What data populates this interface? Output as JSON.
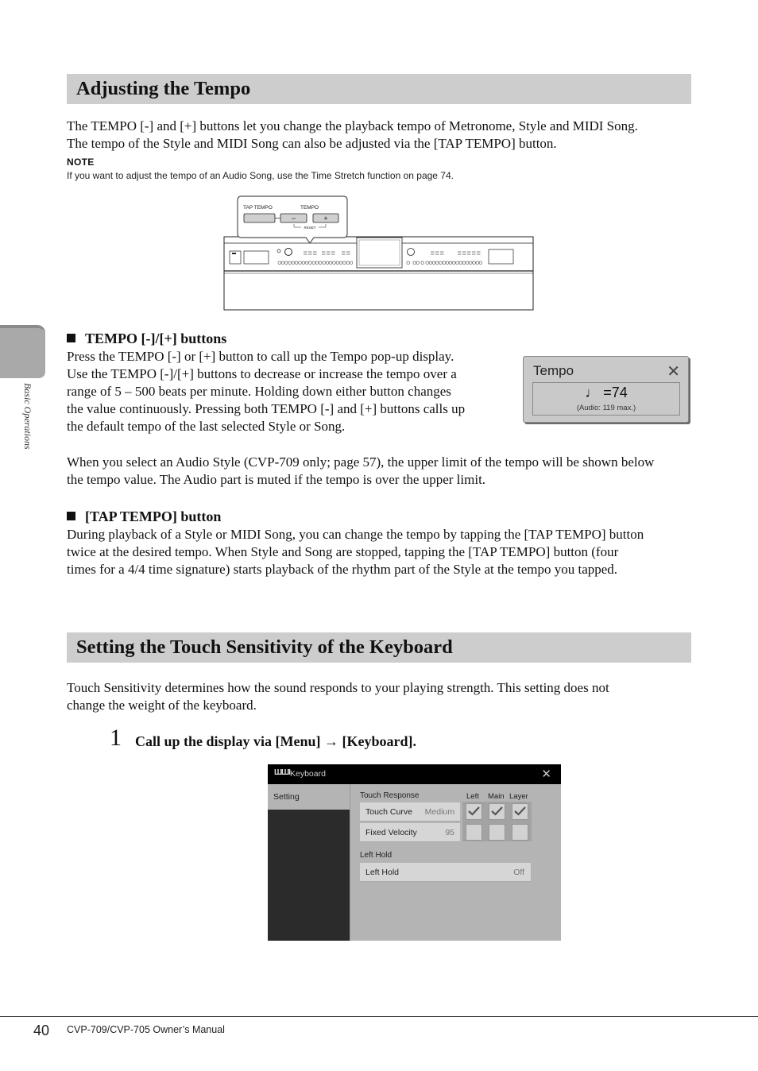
{
  "section1": {
    "heading": "Adjusting the Tempo",
    "intro_line1": "The TEMPO [-] and [+] buttons let you change the playback tempo of Metronome, Style and MIDI Song.",
    "intro_line2": "The tempo of the Style and MIDI Song can also be adjusted via the [TAP TEMPO] button.",
    "note_label": "NOTE",
    "note_text": "If you want to adjust the tempo of an Audio Song, use the Time Stretch function on page 74.",
    "illustration": {
      "tap_tempo_label": "TAP TEMPO",
      "tempo_label": "TEMPO",
      "minus_label": "−",
      "plus_label": "+",
      "reset_label": "RESET"
    },
    "sub1": {
      "heading": "TEMPO [-]/[+] buttons",
      "lines": [
        "Press the TEMPO [-] or [+] button to call up the Tempo pop-up display.",
        "Use the TEMPO [-]/[+] buttons to decrease or increase the tempo over a",
        "range of 5 – 500 beats per minute. Holding down either button changes",
        "the value continuously. Pressing both TEMPO [-] and [+] buttons calls up",
        "the default tempo of the last selected Style or Song."
      ],
      "audio_line1": "When you select an Audio Style (CVP-709 only; page 57), the upper limit of the tempo will be shown below",
      "audio_line2": "the tempo value. The Audio part is muted if the tempo is over the upper limit."
    },
    "tempo_popup": {
      "title": "Tempo",
      "close_icon": "✕",
      "value": "♩ =74",
      "audio_max": "(Audio: 119 max.)"
    },
    "sub2": {
      "heading": "[TAP TEMPO] button",
      "lines": [
        "During playback of a Style or MIDI Song, you can change the tempo by tapping the [TAP TEMPO] button",
        "twice at the desired tempo. When Style and Song are stopped, tapping the [TAP TEMPO] button (four",
        "times for a 4/4 time signature) starts playback of the rhythm part of the Style at the tempo you tapped."
      ]
    }
  },
  "section2": {
    "heading": "Setting the Touch Sensitivity of the Keyboard",
    "intro_line1": "Touch Sensitivity determines how the sound responds to your playing strength. This setting does not",
    "intro_line2": "change the weight of the keyboard.",
    "step": {
      "number": "1",
      "text": "Call up the display via [Menu] → [Keyboard]."
    },
    "keyboard_screen": {
      "title_icon": "ШШІ",
      "title": "Keyboard",
      "close_icon": "✕",
      "left_tab": "Setting",
      "touch_response_label": "Touch Response",
      "columns": [
        "Left",
        "Main",
        "Layer"
      ],
      "rows": [
        {
          "name": "Touch Curve",
          "value": "Medium",
          "checks": [
            true,
            true,
            true
          ]
        },
        {
          "name": "Fixed Velocity",
          "value": "95",
          "checks": [
            false,
            false,
            false
          ]
        }
      ],
      "left_hold_label": "Left Hold",
      "left_hold_row": {
        "name": "Left Hold",
        "value": "Off"
      }
    }
  },
  "sidebar": {
    "section_label": "Basic Operations"
  },
  "footer": {
    "page_number": "40",
    "manual_title": "CVP-709/CVP-705 Owner’s Manual"
  }
}
